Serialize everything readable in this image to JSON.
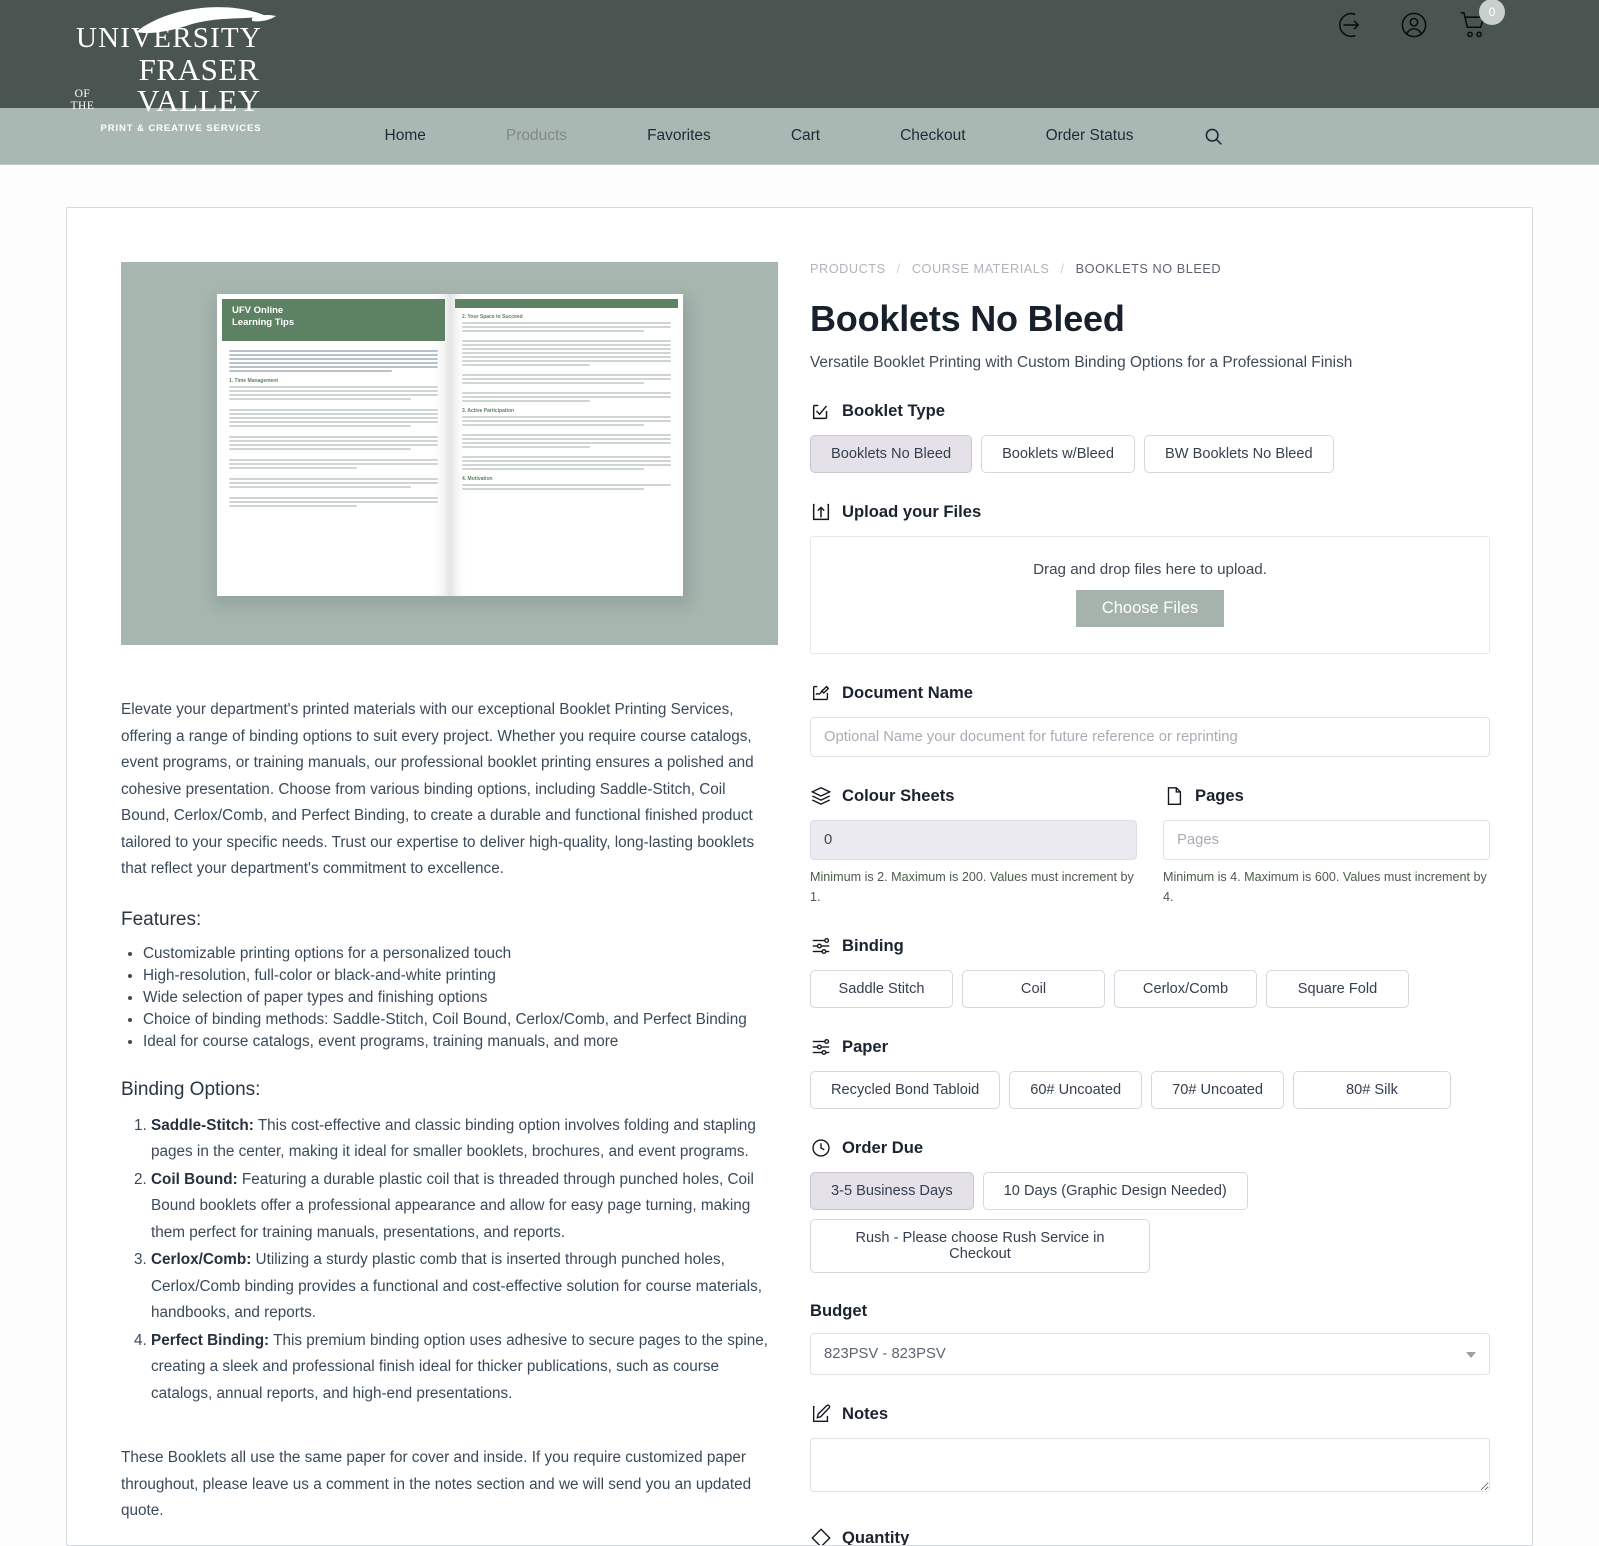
{
  "header": {
    "logo": {
      "line1": "UNIVERSITY",
      "of_the": "OF THE",
      "line2": "FRASER VALLEY",
      "tagline": "PRINT & CREATIVE SERVICES"
    },
    "icons": [
      {
        "name": "sign-in-icon",
        "label": "Sign In"
      },
      {
        "name": "account-icon",
        "label": "Account"
      },
      {
        "name": "cart-icon",
        "label": "Cart"
      }
    ],
    "cart_count": "0"
  },
  "nav": {
    "items": [
      {
        "label": "Home",
        "muted": false
      },
      {
        "label": "Products",
        "muted": true
      },
      {
        "label": "Favorites",
        "muted": false
      },
      {
        "label": "Cart",
        "muted": false
      },
      {
        "label": "Checkout",
        "muted": false
      },
      {
        "label": "Order Status",
        "muted": false
      }
    ],
    "search_icon": "search-icon"
  },
  "product_image": {
    "alt": "Open booklet spread - UFV Online Learning Tips",
    "cover_title_line1": "UFV Online",
    "cover_title_line2": "Learning Tips",
    "left_sections": [
      "1. Time Management"
    ],
    "right_sections": [
      "2. Your Space to Succeed",
      "3. Active Participation",
      "4. Motivation"
    ]
  },
  "description": {
    "paragraph": "Elevate your department's printed materials with our exceptional Booklet Printing Services, offering a range of binding options to suit every project. Whether you require course catalogs, event programs, or training manuals, our professional booklet printing ensures a polished and cohesive presentation. Choose from various binding options, including Saddle-Stitch, Coil Bound, Cerlox/Comb, and Perfect Binding, to create a durable and functional finished product tailored to your specific needs. Trust our expertise to deliver high-quality, long-lasting booklets that reflect your department's commitment to excellence.",
    "features_heading": "Features:",
    "features": [
      "Customizable printing options for a personalized touch",
      "High-resolution, full-color or black-and-white printing",
      "Wide selection of paper types and finishing options",
      "Choice of binding methods: Saddle-Stitch, Coil Bound, Cerlox/Comb, and Perfect Binding",
      "Ideal for course catalogs, event programs, training manuals, and more"
    ],
    "binding_heading": "Binding Options:",
    "binding_options": [
      {
        "term": "Saddle-Stitch:",
        "text": " This cost-effective and classic binding option involves folding and stapling pages in the center, making it ideal for smaller booklets, brochures, and event programs."
      },
      {
        "term": "Coil Bound:",
        "text": " Featuring a durable plastic coil that is threaded through punched holes, Coil Bound booklets offer a professional appearance and allow for easy page turning, making them perfect for training manuals, presentations, and reports."
      },
      {
        "term": "Cerlox/Comb:",
        "text": " Utilizing a sturdy plastic comb that is inserted through punched holes, Cerlox/Comb binding provides a functional and cost-effective solution for course materials, handbooks, and reports."
      },
      {
        "term": "Perfect Binding:",
        "text": " This premium binding option uses adhesive to secure pages to the spine, creating a sleek and professional finish ideal for thicker publications, such as course catalogs, annual reports, and high-end presentations."
      }
    ],
    "closing": "These Booklets all use the same paper for cover and inside. If you require customized paper throughout, please leave us a comment in the notes section and we will send you an updated quote."
  },
  "breadcrumb": {
    "items": [
      "PRODUCTS",
      "COURSE MATERIALS",
      "BOOKLETS NO BLEED"
    ],
    "separator": "/"
  },
  "product": {
    "title": "Booklets No Bleed",
    "subtitle": "Versatile Booklet Printing with Custom Binding Options for a Professional Finish"
  },
  "form": {
    "booklet_type": {
      "label": "Booklet Type",
      "icon": "checkbox-check-icon",
      "options": [
        {
          "label": "Booklets No Bleed",
          "selected": true
        },
        {
          "label": "Booklets w/Bleed",
          "selected": false
        },
        {
          "label": "BW Booklets No Bleed",
          "selected": false
        }
      ]
    },
    "upload": {
      "label": "Upload your Files",
      "icon": "upload-box-icon",
      "drop_text": "Drag and drop files here to upload.",
      "button_label": "Choose Files"
    },
    "document_name": {
      "label": "Document Name",
      "icon": "signature-icon",
      "placeholder": "Optional Name your document for future reference or reprinting",
      "value": ""
    },
    "colour_sheets": {
      "label": "Colour Sheets",
      "icon": "layers-icon",
      "value": "0",
      "hint": "Minimum is 2. Maximum is 200. Values must increment by 1."
    },
    "pages": {
      "label": "Pages",
      "icon": "page-icon",
      "placeholder": "Pages",
      "value": "",
      "hint": "Minimum is 4. Maximum is 600. Values must increment by 4."
    },
    "binding": {
      "label": "Binding",
      "icon": "sliders-icon",
      "options": [
        {
          "label": "Saddle Stitch",
          "selected": false
        },
        {
          "label": "Coil",
          "selected": false
        },
        {
          "label": "Cerlox/Comb",
          "selected": false
        },
        {
          "label": "Square Fold",
          "selected": false
        }
      ]
    },
    "paper": {
      "label": "Paper",
      "icon": "sliders-icon",
      "options": [
        {
          "label": "Recycled Bond Tabloid",
          "selected": false
        },
        {
          "label": "60# Uncoated",
          "selected": false
        },
        {
          "label": "70# Uncoated",
          "selected": false
        },
        {
          "label": "80# Silk",
          "selected": false
        }
      ]
    },
    "order_due": {
      "label": "Order Due",
      "icon": "clock-icon",
      "options": [
        {
          "label": "3-5 Business Days",
          "selected": true
        },
        {
          "label": "10 Days (Graphic Design Needed)",
          "selected": false
        },
        {
          "label": "Rush - Please choose Rush Service in Checkout",
          "selected": false
        }
      ]
    },
    "budget": {
      "label": "Budget",
      "selected": "823PSV - 823PSV"
    },
    "notes": {
      "label": "Notes",
      "icon": "pencil-icon",
      "value": ""
    },
    "quantity": {
      "label": "Quantity",
      "icon": "tag-icon"
    }
  },
  "colors": {
    "header_bg": "#4a5552",
    "nav_bg": "#aab8b3",
    "accent_button": "#a6b3ad",
    "selected_option": "#e4e1e9",
    "product_image_bg": "#a6b7b0"
  }
}
